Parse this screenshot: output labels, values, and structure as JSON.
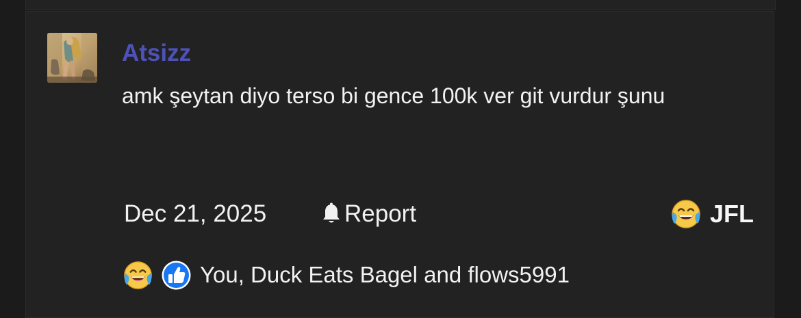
{
  "post": {
    "username": "Atsizz",
    "message": "amk şeytan diyo terso bi gence 100k ver git vurdur şunu",
    "date": "Dec 21, 2025",
    "report_label": "Report",
    "reaction_label": "JFL",
    "reaction_emoji": "joy-emoji",
    "reacted_by": "You, Duck Eats Bagel and flows5991"
  },
  "colors": {
    "background": "#1b1b1c",
    "post_background": "#222223",
    "username": "#4e52b8",
    "text": "#f2f2f2",
    "like_badge": "#1877f2"
  },
  "icons": {
    "report": "bell-icon",
    "reaction_summary": [
      "joy-emoji",
      "thumbs-up-icon"
    ]
  }
}
